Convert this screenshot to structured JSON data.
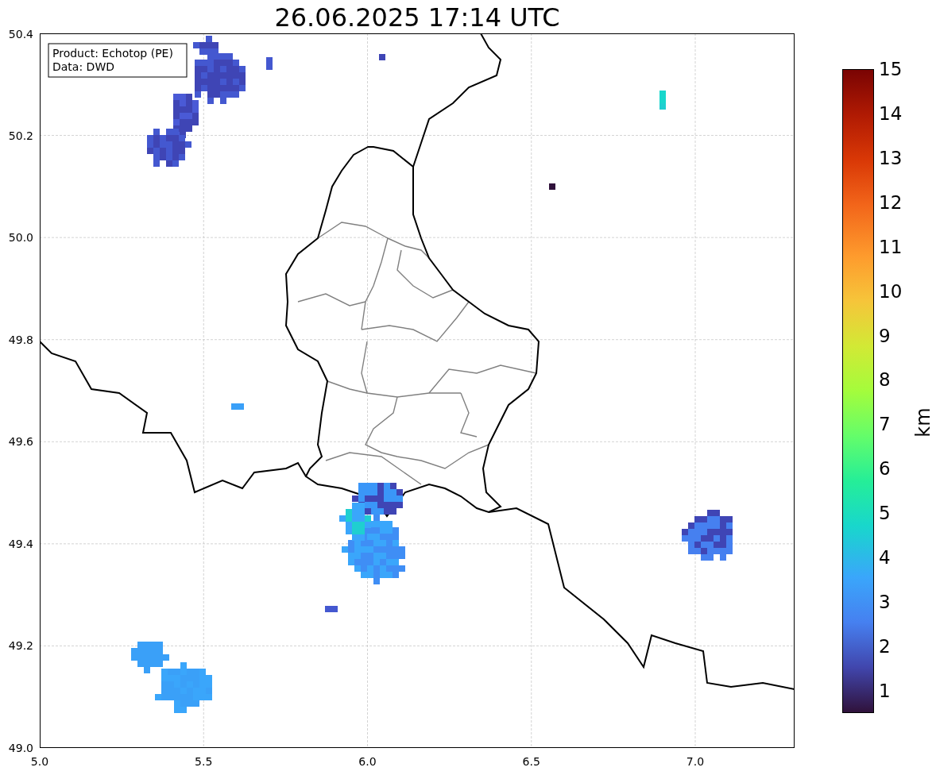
{
  "title": "26.06.2025 17:14 UTC",
  "info_box": [
    "Product: Echotop (PE)",
    "Data: DWD"
  ],
  "x_ticks": [
    "5.0",
    "5.5",
    "6.0",
    "6.5",
    "7.0"
  ],
  "y_ticks": [
    "50.4",
    "50.2",
    "50.0",
    "49.8",
    "49.6",
    "49.4",
    "49.2",
    "49.0"
  ],
  "colorbar": {
    "label": "km",
    "ticks": [
      "15",
      "14",
      "13",
      "12",
      "11",
      "10",
      "9",
      "8",
      "7",
      "6",
      "5",
      "4",
      "3",
      "2",
      "1"
    ]
  }
}
